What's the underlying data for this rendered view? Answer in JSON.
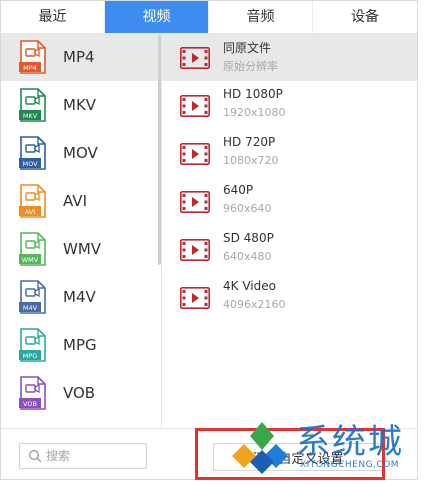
{
  "tabs": [
    {
      "label": "最近",
      "active": false
    },
    {
      "label": "视频",
      "active": true
    },
    {
      "label": "音频",
      "active": false
    },
    {
      "label": "设备",
      "active": false
    }
  ],
  "formats": [
    {
      "label": "MP4",
      "tag": "MP4",
      "color": "#e05a2a",
      "selected": true
    },
    {
      "label": "MKV",
      "tag": "MKV",
      "color": "#1e8a52",
      "selected": false
    },
    {
      "label": "MOV",
      "tag": "MOV",
      "color": "#2d5ea6",
      "selected": false
    },
    {
      "label": "AVI",
      "tag": "AVI",
      "color": "#f08c24",
      "selected": false
    },
    {
      "label": "WMV",
      "tag": "WMV",
      "color": "#53b957",
      "selected": false
    },
    {
      "label": "M4V",
      "tag": "M4V",
      "color": "#4a6aa8",
      "selected": false
    },
    {
      "label": "MPG",
      "tag": "MPG",
      "color": "#2aa89a",
      "selected": false
    },
    {
      "label": "VOB",
      "tag": "VOB",
      "color": "#8a4fc0",
      "selected": false
    }
  ],
  "presets": [
    {
      "name": "同原文件",
      "res": "原始分辨率",
      "selected": true
    },
    {
      "name": "HD 1080P",
      "res": "1920x1080",
      "selected": false
    },
    {
      "name": "HD 720P",
      "res": "1080x720",
      "selected": false
    },
    {
      "name": "640P",
      "res": "960x640",
      "selected": false
    },
    {
      "name": "SD 480P",
      "res": "640x480",
      "selected": false
    },
    {
      "name": "4K Video",
      "res": "4096x2160",
      "selected": false
    }
  ],
  "search": {
    "placeholder": "搜索",
    "value": ""
  },
  "add_button": {
    "label": "添加自定义设置"
  },
  "watermark": {
    "text": "系统城",
    "sub": "XITONGCHENG.COM"
  },
  "colors": {
    "accent": "#3d8cf0",
    "video_icon": "#c0282e",
    "highlight_box": "#e8302f"
  }
}
